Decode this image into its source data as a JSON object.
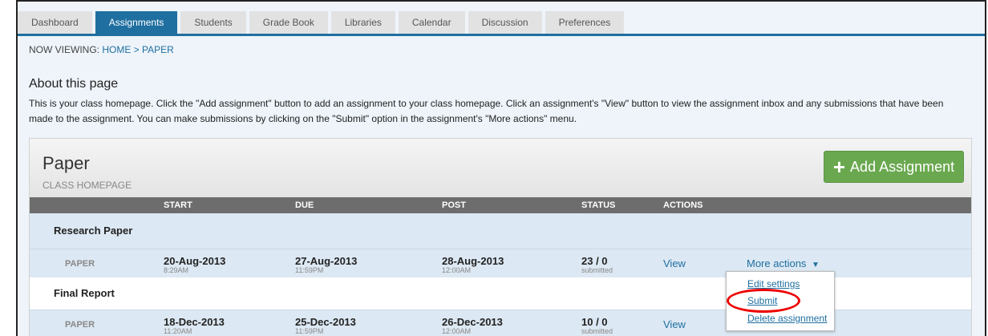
{
  "tabs": [
    "Dashboard",
    "Assignments",
    "Students",
    "Grade Book",
    "Libraries",
    "Calendar",
    "Discussion",
    "Preferences"
  ],
  "active_tab": "Assignments",
  "breadcrumb": {
    "prefix": "NOW VIEWING: ",
    "home": "HOME",
    "separator": " > ",
    "current": "PAPER"
  },
  "about": {
    "title": "About this page",
    "text": "This is your class homepage. Click the \"Add assignment\" button to add an assignment to your class homepage. Click an assignment's \"View\" button to view the assignment inbox and any submissions that have been made to the assignment. You can make submissions by clicking on the \"Submit\" option in the assignment's \"More actions\" menu."
  },
  "panel": {
    "title": "Paper",
    "subtitle": "CLASS HOMEPAGE",
    "add_button": "Add Assignment"
  },
  "columns": {
    "start": "START",
    "due": "DUE",
    "post": "POST",
    "status": "STATUS",
    "actions": "ACTIONS"
  },
  "assignments": [
    {
      "name": "Research Paper",
      "type": "PAPER",
      "start_date": "20-Aug-2013",
      "start_time": "8:29AM",
      "due_date": "27-Aug-2013",
      "due_time": "11:59PM",
      "post_date": "28-Aug-2013",
      "post_time": "12:00AM",
      "status": "23 / 0",
      "status_sub": "submitted",
      "view": "View",
      "more": "More actions"
    },
    {
      "name": "Final Report",
      "type": "PAPER",
      "start_date": "18-Dec-2013",
      "start_time": "11:20AM",
      "due_date": "25-Dec-2013",
      "due_time": "11:59PM",
      "post_date": "26-Dec-2013",
      "post_time": "12:00AM",
      "status": "10 / 0",
      "status_sub": "submitted",
      "view": "View"
    }
  ],
  "dropdown": [
    "Edit settings",
    "Submit",
    "Delete assignment"
  ],
  "colors": {
    "accent": "#1f6fa0",
    "add_button": "#6aa84f",
    "highlight": "#e00000",
    "row_blue": "#dce8f3"
  }
}
